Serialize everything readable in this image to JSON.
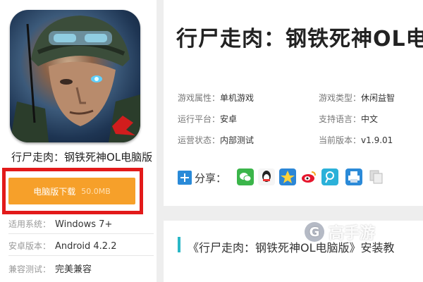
{
  "app": {
    "name": "行尸走肉：钢铁死神OL电脑版",
    "download_label": "电脑版下载",
    "download_size": "50.0MB"
  },
  "specs": [
    {
      "label": "适用系统：",
      "value": "Windows 7+"
    },
    {
      "label": "安卓版本：",
      "value": "Android 4.2.2"
    },
    {
      "label": "兼容测试：",
      "value": "完美兼容"
    }
  ],
  "main": {
    "title": "行尸走肉：钢铁死神OL电脑版",
    "attributes": [
      {
        "label": "游戏属性：",
        "value": "单机游戏"
      },
      {
        "label": "游戏类型：",
        "value": "休闲益智"
      },
      {
        "label": "运行平台：",
        "value": "安卓"
      },
      {
        "label": "支持语言：",
        "value": "中文"
      },
      {
        "label": "运营状态：",
        "value": "内部测试"
      },
      {
        "label": "当前版本：",
        "value": "v1.9.01"
      }
    ],
    "share_label": "分享：",
    "share_icons": [
      "wechat-icon",
      "qq-icon",
      "qzone-icon",
      "weibo-icon",
      "tencent-weibo-icon",
      "print-icon",
      "copy-icon"
    ],
    "bottom_title": "《行尸走肉：钢铁死神OL电脑版》安装教"
  },
  "watermark": {
    "text": "高手游",
    "logo": "G"
  },
  "colors": {
    "download": "#f6a02a",
    "highlight_frame": "#e21a1a",
    "accent_bar": "#2ab7c6",
    "plus": "#2a8ad8"
  }
}
